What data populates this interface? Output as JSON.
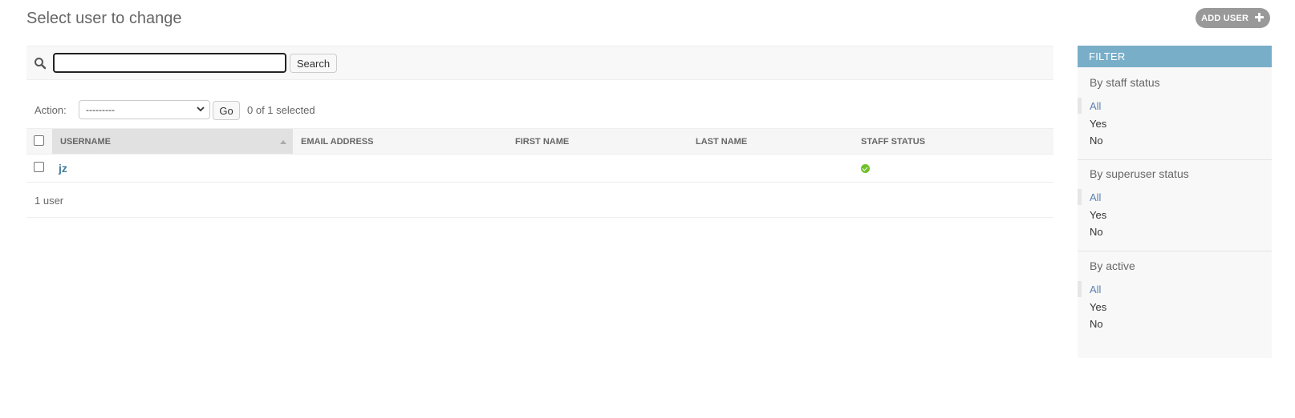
{
  "page_title": "Select user to change",
  "add_button": {
    "label": "ADD USER",
    "icon": "plus-icon"
  },
  "search": {
    "value": "",
    "placeholder": "",
    "button_label": "Search",
    "icon": "search-icon"
  },
  "actions": {
    "label": "Action:",
    "selected_option": "---------",
    "go_label": "Go",
    "selected_count": "0 of 1 selected"
  },
  "table": {
    "columns": [
      "USERNAME",
      "EMAIL ADDRESS",
      "FIRST NAME",
      "LAST NAME",
      "STAFF STATUS"
    ],
    "rows": [
      {
        "username": "jz",
        "email": "",
        "first_name": "",
        "last_name": "",
        "staff_status": true
      }
    ],
    "paginator": "1 user"
  },
  "filter": {
    "header": "FILTER",
    "sections": [
      {
        "title": "By staff status",
        "items": [
          "All",
          "Yes",
          "No"
        ],
        "selected": "All"
      },
      {
        "title": "By superuser status",
        "items": [
          "All",
          "Yes",
          "No"
        ],
        "selected": "All"
      },
      {
        "title": "By active",
        "items": [
          "All",
          "Yes",
          "No"
        ],
        "selected": "All"
      }
    ]
  },
  "colors": {
    "header_accent": "#79aec8",
    "link": "#447e9b",
    "status_ok": "#70bf2b"
  }
}
